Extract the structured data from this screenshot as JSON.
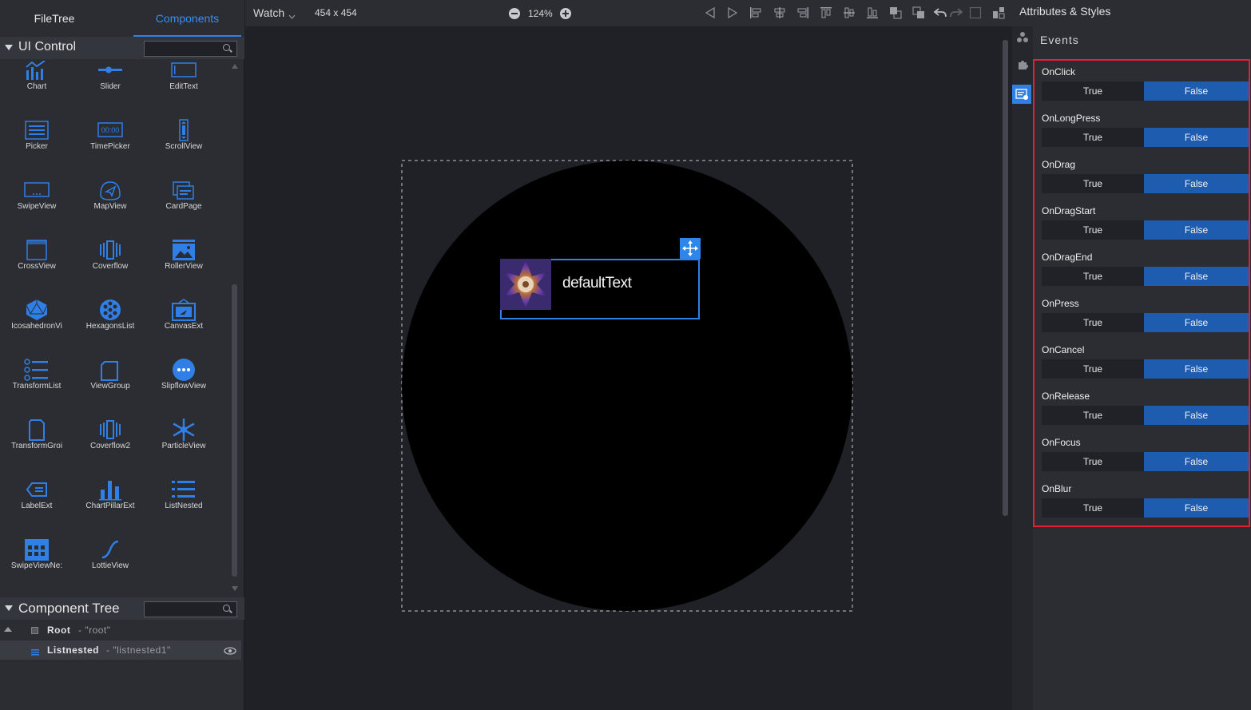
{
  "left_panel": {
    "tabs": [
      "FileTree",
      "Components"
    ],
    "ui_control_title": "UI Control",
    "ui_control_search_placeholder": "",
    "components": [
      {
        "label": "Chart",
        "icon": "chart-icon"
      },
      {
        "label": "Slider",
        "icon": "slider-icon"
      },
      {
        "label": "EditText",
        "icon": "edittext-icon"
      },
      {
        "label": "Picker",
        "icon": "picker-icon"
      },
      {
        "label": "TimePicker",
        "icon": "timepicker-icon",
        "icon_text": "00:00"
      },
      {
        "label": "ScrollView",
        "icon": "scrollview-icon"
      },
      {
        "label": "SwipeView",
        "icon": "swipeview-icon"
      },
      {
        "label": "MapView",
        "icon": "mapview-icon"
      },
      {
        "label": "CardPage",
        "icon": "cardpage-icon"
      },
      {
        "label": "CrossView",
        "icon": "crossview-icon"
      },
      {
        "label": "Coverflow",
        "icon": "coverflow-icon"
      },
      {
        "label": "RollerView",
        "icon": "rollerview-icon"
      },
      {
        "label": "IcosahedronVi",
        "icon": "icosahedron-icon"
      },
      {
        "label": "HexagonsList",
        "icon": "hexagonslist-icon"
      },
      {
        "label": "CanvasExt",
        "icon": "canvasext-icon"
      },
      {
        "label": "TransformList",
        "icon": "transformlist-icon"
      },
      {
        "label": "ViewGroup",
        "icon": "viewgroup-icon"
      },
      {
        "label": "SlipflowView",
        "icon": "slipflowview-icon"
      },
      {
        "label": "TransformGroi",
        "icon": "transformgroup-icon"
      },
      {
        "label": "Coverflow2",
        "icon": "coverflow2-icon"
      },
      {
        "label": "ParticleView",
        "icon": "particleview-icon"
      },
      {
        "label": "LabelExt",
        "icon": "labelext-icon"
      },
      {
        "label": "ChartPillarExt",
        "icon": "chartpillar-icon"
      },
      {
        "label": "ListNested",
        "icon": "listnested-icon"
      },
      {
        "label": "SwipeViewNe:",
        "icon": "swipeviewnested-icon"
      },
      {
        "label": "LottieView",
        "icon": "lottieview-icon"
      }
    ],
    "component_tree_title": "Component Tree",
    "tree": [
      {
        "name": "Root",
        "id": "- \"root\""
      },
      {
        "name": "Listnested",
        "id": "- \"listnested1\""
      }
    ]
  },
  "toolbar": {
    "device": "Watch",
    "resolution": "454 x 454",
    "zoom": "124%"
  },
  "canvas": {
    "widget_text": "defaultText"
  },
  "right_panel": {
    "title": "Attributes & Styles",
    "section": "Events",
    "true_label": "True",
    "false_label": "False",
    "events": [
      {
        "name": "OnClick",
        "value": "False"
      },
      {
        "name": "OnLongPress",
        "value": "False"
      },
      {
        "name": "OnDrag",
        "value": "False"
      },
      {
        "name": "OnDragStart",
        "value": "False"
      },
      {
        "name": "OnDragEnd",
        "value": "False"
      },
      {
        "name": "OnPress",
        "value": "False"
      },
      {
        "name": "OnCancel",
        "value": "False"
      },
      {
        "name": "OnRelease",
        "value": "False"
      },
      {
        "name": "OnFocus",
        "value": "False"
      },
      {
        "name": "OnBlur",
        "value": "False"
      }
    ]
  },
  "colors": {
    "accent": "#2f7fe6",
    "selected_option": "#1d5cae",
    "highlight_border": "#e02232",
    "panel_bg": "#2b2d33"
  }
}
